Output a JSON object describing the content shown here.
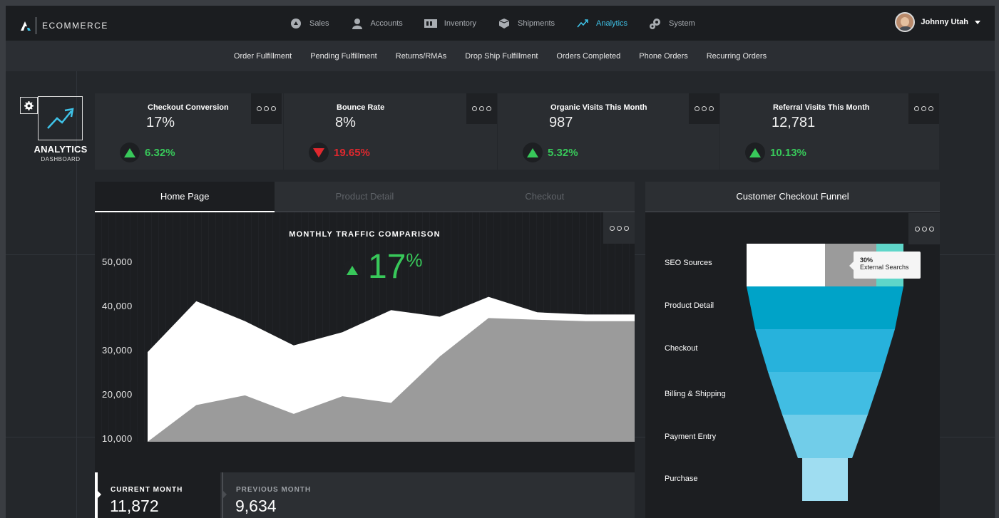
{
  "brand": {
    "name": "ECOMMERCE"
  },
  "nav": {
    "items": [
      {
        "label": "Sales",
        "icon": "sales-icon",
        "active": false
      },
      {
        "label": "Accounts",
        "icon": "accounts-icon",
        "active": false
      },
      {
        "label": "Inventory",
        "icon": "inventory-icon",
        "active": false
      },
      {
        "label": "Shipments",
        "icon": "shipments-icon",
        "active": false
      },
      {
        "label": "Analytics",
        "icon": "analytics-icon",
        "active": true
      },
      {
        "label": "System",
        "icon": "system-icon",
        "active": false
      }
    ],
    "active_color": "#3fc3e8"
  },
  "user": {
    "name": "Johnny Utah"
  },
  "subnav": {
    "items": [
      "Order Fulfillment",
      "Pending Fulfillment",
      "Returns/RMAs",
      "Drop Ship Fulfillment",
      "Orders Completed",
      "Phone Orders",
      "Recurring Orders"
    ]
  },
  "dashboard": {
    "title": "ANALYTICS",
    "subtitle": "DASHBOARD"
  },
  "kpis": [
    {
      "title": "Checkout Conversion",
      "value": "17%",
      "change": "6.32%",
      "direction": "up"
    },
    {
      "title": "Bounce Rate",
      "value": "8%",
      "change": "19.65%",
      "direction": "down"
    },
    {
      "title": "Organic Visits This Month",
      "value": "987",
      "change": "5.32%",
      "direction": "up"
    },
    {
      "title": "Referral Visits This Month",
      "value": "12,781",
      "change": "10.13%",
      "direction": "up"
    }
  ],
  "colors": {
    "up": "#38c85a",
    "down": "#e0282e"
  },
  "tabs": [
    {
      "label": "Home Page",
      "active": true
    },
    {
      "label": "Product Detail",
      "active": false
    },
    {
      "label": "Checkout",
      "active": false
    }
  ],
  "traffic": {
    "title": "MONTHLY TRAFFIC COMPARISON",
    "percent": "17",
    "percent_symbol": "%",
    "current_label": "CURRENT MONTH",
    "current_value": "11,872",
    "previous_label": "PREVIOUS MONTH",
    "previous_value": "9,634"
  },
  "chart_data": {
    "type": "area",
    "title": "MONTHLY TRAFFIC COMPARISON",
    "ylim": [
      0,
      50000
    ],
    "yticks": [
      "50,000",
      "40,000",
      "30,000",
      "20,000",
      "10,000"
    ],
    "ytick_values": [
      50000,
      40000,
      30000,
      20000,
      10000
    ],
    "x": [
      0,
      1,
      2,
      3,
      4,
      5,
      6,
      7,
      8,
      9,
      10
    ],
    "series": [
      {
        "values": [
          29500,
          41000,
          36500,
          31000,
          34000,
          39000,
          37500,
          42000,
          38500,
          38000,
          38000
        ],
        "color": "#ffffff"
      },
      {
        "values": [
          2200,
          17500,
          19700,
          15500,
          19500,
          18000,
          28500,
          37200,
          36800,
          36500,
          36500
        ],
        "color": "#9b9b9b"
      }
    ]
  },
  "funnel": {
    "title": "Customer Checkout Funnel",
    "stages": [
      "SEO Sources",
      "Product Detail",
      "Checkout",
      "Billing & Shipping",
      "Payment Entry",
      "Purchase"
    ],
    "tooltip_pct": "30%",
    "tooltip_label": "External Searchs",
    "colors": [
      "#ffffff",
      "#00a3c8",
      "#27b2dc",
      "#41bde3",
      "#71cde9",
      "#9fddf1"
    ]
  }
}
